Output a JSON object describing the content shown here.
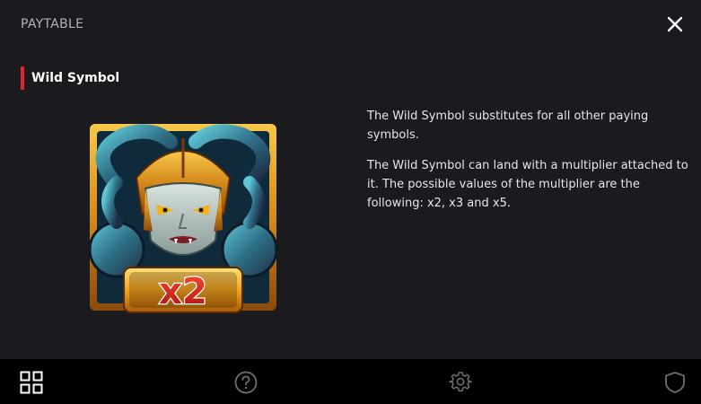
{
  "header": {
    "title": "PAYTABLE",
    "close_icon": "close-icon"
  },
  "section": {
    "title": "Wild Symbol",
    "accent_color": "#e0262b"
  },
  "symbol": {
    "multiplier_label": "x2",
    "icon": "wild-medusa-symbol"
  },
  "description": {
    "paragraphs": [
      "The Wild Symbol substitutes for all other paying symbols.",
      "The Wild Symbol can land with a multiplier attached to it. The possible values of the multiplier are the following: x2, x3 and x5."
    ]
  },
  "footer": {
    "buttons": [
      {
        "name": "paytable-button",
        "icon": "grid-icon"
      },
      {
        "name": "help-button",
        "icon": "question-icon"
      },
      {
        "name": "settings-button",
        "icon": "gear-icon"
      },
      {
        "name": "security-button",
        "icon": "shield-icon"
      }
    ]
  }
}
